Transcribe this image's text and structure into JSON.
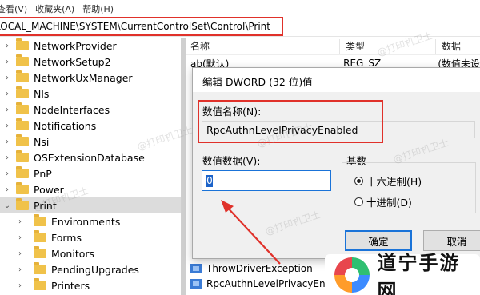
{
  "menu": [
    "查看(V)",
    "收藏夹(A)",
    "帮助(H)"
  ],
  "address": "LOCAL_MACHINE\\SYSTEM\\CurrentControlSet\\Control\\Print",
  "tree_items": [
    {
      "label": "NetworkProvider",
      "expanded": false
    },
    {
      "label": "NetworkSetup2",
      "expanded": false
    },
    {
      "label": "NetworkUxManager",
      "expanded": false
    },
    {
      "label": "Nls",
      "expanded": false
    },
    {
      "label": "NodeInterfaces",
      "expanded": false
    },
    {
      "label": "Notifications",
      "expanded": false
    },
    {
      "label": "Nsi",
      "expanded": false
    },
    {
      "label": "OSExtensionDatabase",
      "expanded": false
    },
    {
      "label": "PnP",
      "expanded": false
    },
    {
      "label": "Power",
      "expanded": false
    },
    {
      "label": "Print",
      "expanded": true,
      "selected": true
    },
    {
      "label": "Environments",
      "expanded": false,
      "child": true
    },
    {
      "label": "Forms",
      "expanded": false,
      "child": true
    },
    {
      "label": "Monitors",
      "expanded": false,
      "child": true
    },
    {
      "label": "PendingUpgrades",
      "expanded": false,
      "child": true
    },
    {
      "label": "Printers",
      "expanded": false,
      "child": true
    }
  ],
  "columns": {
    "name": "名称",
    "type": "类型",
    "data": "数据"
  },
  "values": [
    {
      "name": "ab(默认)",
      "type": "REG_SZ",
      "data": "(数值未设"
    },
    {
      "name": "ThrowDriverException",
      "type": "",
      "data": ""
    },
    {
      "name": "RpcAuthnLevelPrivacyEnabled",
      "type": "",
      "data": ""
    }
  ],
  "dialog": {
    "title": "编辑 DWORD (32 位)值",
    "name_label": "数值名称(N):",
    "name_value": "RpcAuthnLevelPrivacyEnabled",
    "data_label": "数值数据(V):",
    "data_value": "0",
    "base_label": "基数",
    "radio_hex": "十六进制(H)",
    "radio_dec": "十进制(D)",
    "hex_selected": true,
    "ok": "确定",
    "cancel": "取消"
  },
  "watermark": "@打印机卫士",
  "brand": "道宁手游网",
  "colors": {
    "highlight": "#e0312a",
    "accent": "#1a73d8"
  }
}
